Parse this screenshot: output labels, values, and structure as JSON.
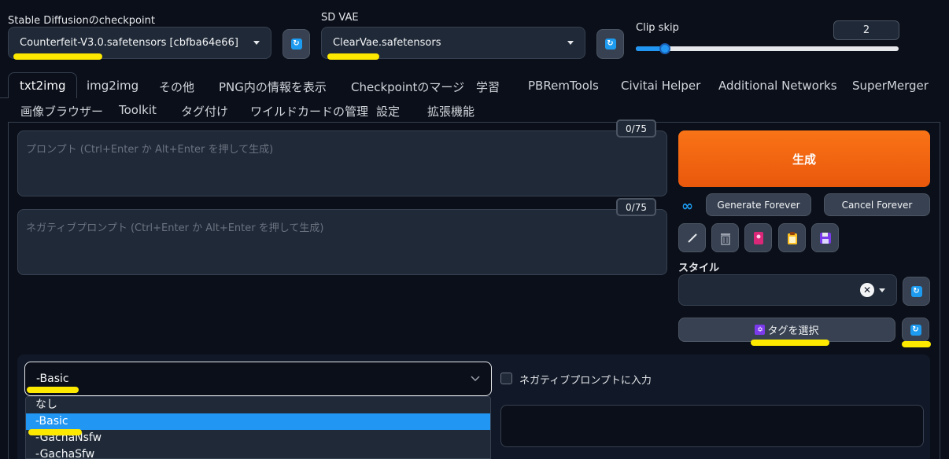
{
  "top": {
    "checkpoint": {
      "label": "Stable Diffusionのcheckpoint",
      "value": "Counterfeit-V3.0.safetensors [cbfba64e66]"
    },
    "vae": {
      "label": "SD VAE",
      "value": "ClearVae.safetensors"
    },
    "clip_skip": {
      "label": "Clip skip",
      "value": "2",
      "slider_fraction": 0.05
    }
  },
  "tabs_row1": [
    "txt2img",
    "img2img",
    "その他",
    "PNG内の情報を表示",
    "Checkpointのマージ",
    "学習",
    "PBRemTools",
    "Civitai Helper",
    "Additional Networks",
    "SuperMerger"
  ],
  "tabs_row2": [
    "画像ブラウザー",
    "Toolkit",
    "タグ付け",
    "ワイルドカードの管理",
    "設定",
    "拡張機能"
  ],
  "prompt": {
    "placeholder": "プロンプト (Ctrl+Enter か Alt+Enter を押して生成)",
    "counter": "0/75"
  },
  "negative_prompt": {
    "placeholder": "ネガティブプロンプト (Ctrl+Enter か Alt+Enter を押して生成)",
    "counter": "0/75"
  },
  "generate": {
    "label": "生成",
    "forever_label": "Generate Forever",
    "cancel_label": "Cancel Forever"
  },
  "style": {
    "label": "スタイル",
    "value": ""
  },
  "tag_select": {
    "label": "タグを選択"
  },
  "preset": {
    "selected": "-Basic",
    "checkbox_label": "ネガティブプロンプトに入力",
    "options": [
      "なし",
      "-Basic",
      "-GachaNsfw",
      "-GachaSfw"
    ],
    "active_index": 1
  },
  "colors": {
    "background": "#0b0f19",
    "accent_orange": "#f97316",
    "highlight_yellow": "#fde900",
    "selected_blue": "#2196f3",
    "refresh_blue": "#1d9bf0"
  }
}
